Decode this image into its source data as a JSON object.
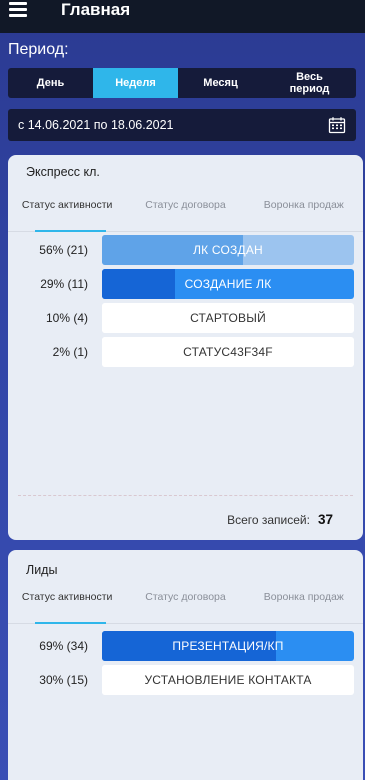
{
  "header": {
    "title": "Главная"
  },
  "period": {
    "label": "Период:",
    "options": [
      "День",
      "Неделя",
      "Месяц",
      "Весь период"
    ],
    "selected": "Неделя",
    "date_range": "с 14.06.2021 по 18.06.2021"
  },
  "express": {
    "title": "Экспресс кл.",
    "tabs": [
      "Статус активности",
      "Статус договора",
      "Воронка продаж"
    ],
    "active_tab": "Статус активности",
    "rows": [
      {
        "pct": "56% (21)",
        "label": "ЛК СОЗДАН",
        "fill": 0.56,
        "color": "#5fa3e8",
        "rest": "#9cc4ef"
      },
      {
        "pct": "29% (11)",
        "label": "СОЗДАНИЕ ЛК",
        "fill": 0.29,
        "color": "#1565d6",
        "rest": "#2b8ef2"
      },
      {
        "pct": "10% (4)",
        "label": "СТАРТОВЫЙ",
        "fill": 0.1,
        "color": "#ffffff",
        "rest": "#ffffff"
      },
      {
        "pct": "2% (1)",
        "label": "СТАТУС43F34F",
        "fill": 0.02,
        "color": "#ffffff",
        "rest": "#ffffff"
      }
    ],
    "total_label": "Всего записей:",
    "total_value": "37"
  },
  "leads": {
    "title": "Лиды",
    "tabs": [
      "Статус активности",
      "Статус договора",
      "Воронка продаж"
    ],
    "active_tab": "Статус активности",
    "rows": [
      {
        "pct": "69% (34)",
        "label": "ПРЕЗЕНТАЦИЯ/КП",
        "fill": 0.69,
        "color": "#1565d6",
        "rest": "#2b8ef2"
      },
      {
        "pct": "30% (15)",
        "label": "УСТАНОВЛЕНИЕ КОНТАКТА",
        "fill": 0.3,
        "color": "#ffffff",
        "rest": "#ffffff"
      }
    ]
  },
  "icons": {
    "menu": "menu-icon",
    "calendar": "calendar-icon"
  },
  "colors": {
    "accent": "#2fb6ea",
    "dark": "#151b3a"
  }
}
